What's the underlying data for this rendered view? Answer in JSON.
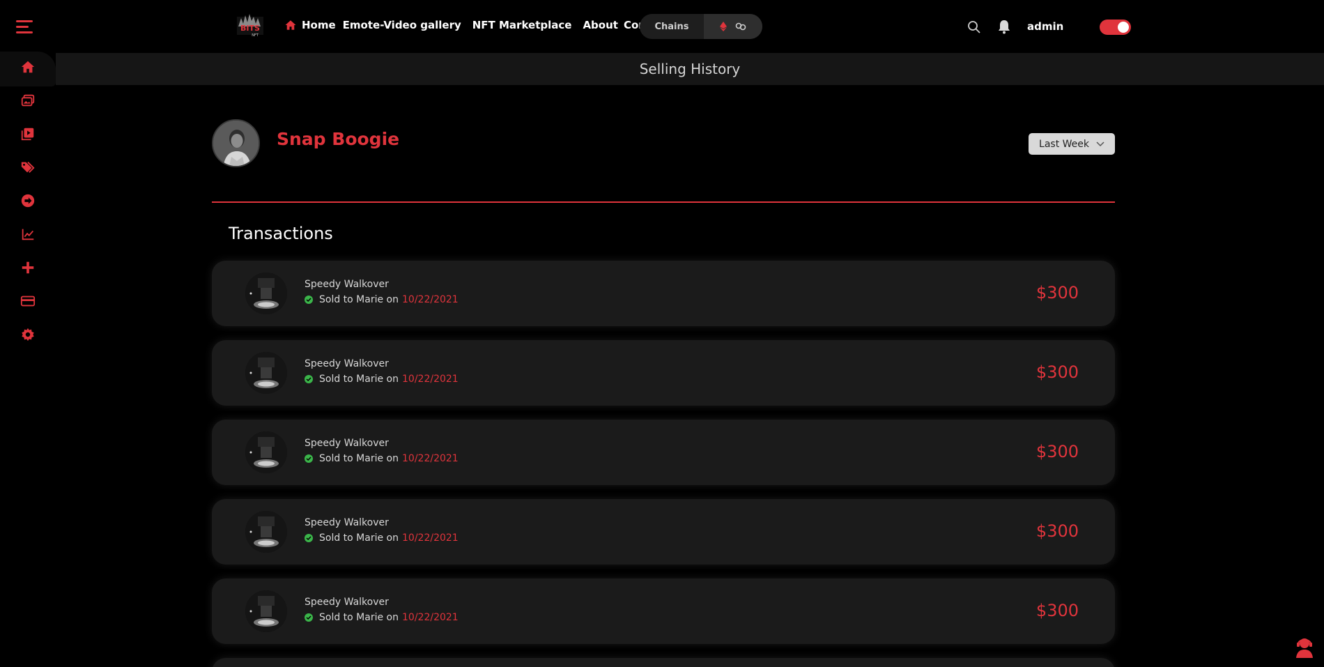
{
  "nav": {
    "links": [
      "Home",
      "Emote-Video gallery",
      "NFT Marketplace",
      "About",
      "Contact"
    ],
    "chains_label": "Chains",
    "user": "admin"
  },
  "page": {
    "title": "Selling History"
  },
  "profile": {
    "name": "Snap Boogie",
    "filter": "Last Week"
  },
  "transactions": {
    "heading": "Transactions",
    "items": [
      {
        "name": "Speedy Walkover",
        "sold_prefix": "Sold to Marie on",
        "date": "10/22/2021",
        "price": "$300"
      },
      {
        "name": "Speedy Walkover",
        "sold_prefix": "Sold to Marie on",
        "date": "10/22/2021",
        "price": "$300"
      },
      {
        "name": "Speedy Walkover",
        "sold_prefix": "Sold to Marie on",
        "date": "10/22/2021",
        "price": "$300"
      },
      {
        "name": "Speedy Walkover",
        "sold_prefix": "Sold to Marie on",
        "date": "10/22/2021",
        "price": "$300"
      },
      {
        "name": "Speedy Walkover",
        "sold_prefix": "Sold to Marie on",
        "date": "10/22/2021",
        "price": "$300"
      }
    ]
  },
  "sidebar": {
    "icons": [
      "home-icon",
      "gallery-icon",
      "video-icon",
      "tags-icon",
      "arrow-circle-icon",
      "chart-icon",
      "plus-icon",
      "card-icon",
      "gear-icon"
    ]
  },
  "colors": {
    "accent": "#e0343c",
    "background": "#000000",
    "card": "#1b1b1b",
    "success": "#3bb54a"
  }
}
